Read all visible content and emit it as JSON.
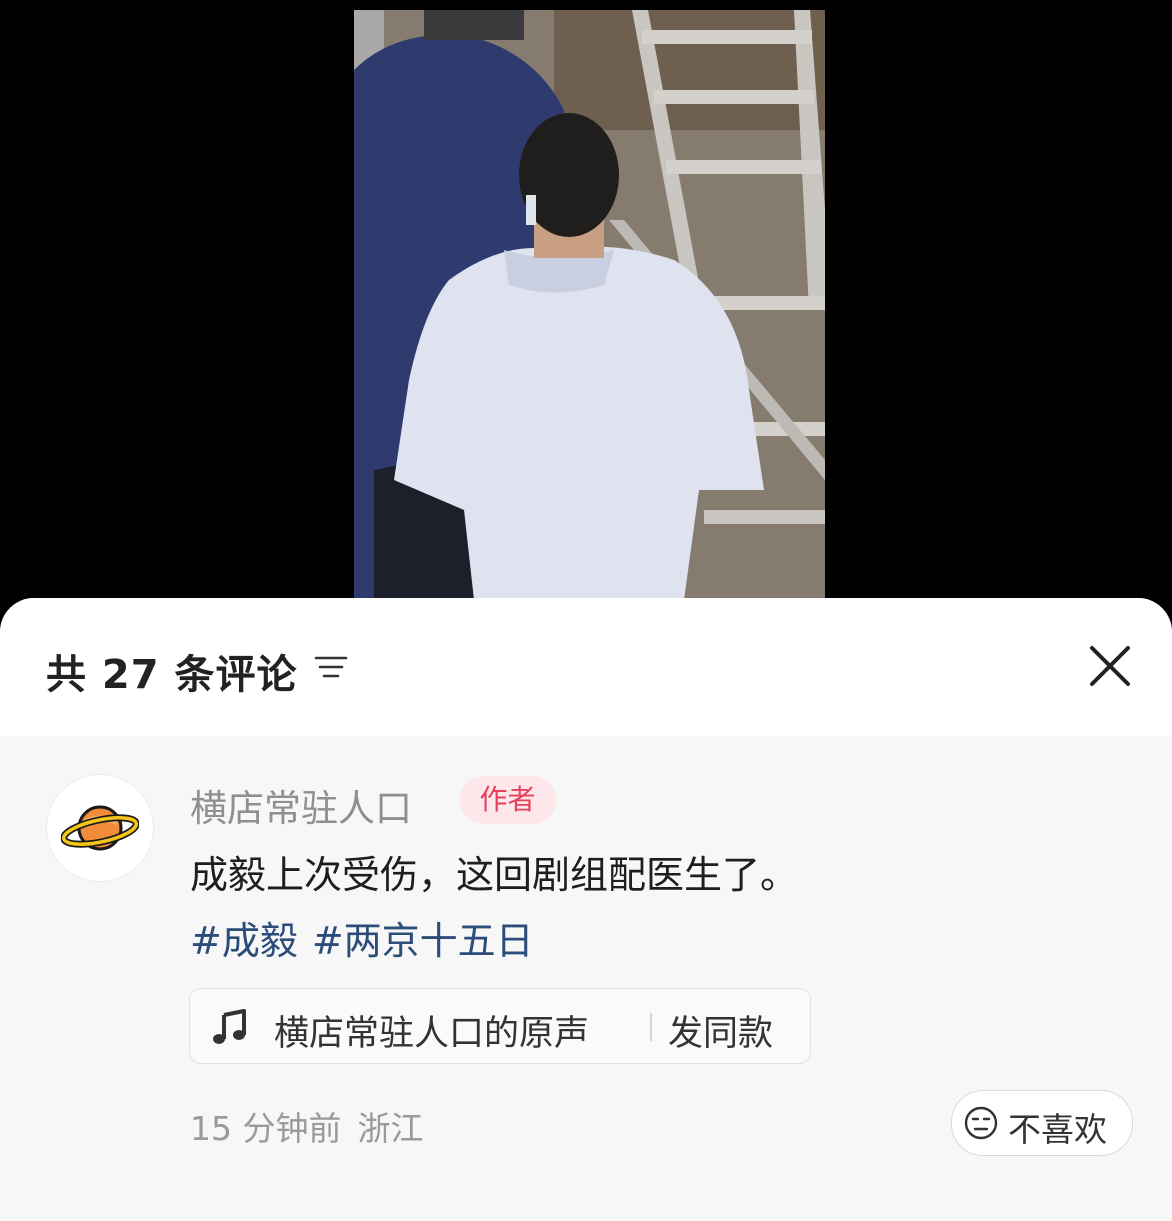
{
  "header": {
    "comment_count_title": "共 27 条评论"
  },
  "icons": {
    "sort": "sort-lines-icon",
    "close": "close-icon",
    "avatar": "planet-icon",
    "music": "music-note-icon",
    "dislike": "neutral-face-icon"
  },
  "comment": {
    "username": "横店常驻人口",
    "badge": "作者",
    "text": "成毅上次受伤，这回剧组配医生了。",
    "tags": [
      "#成毅",
      "#两京十五日"
    ],
    "sound": {
      "name": "横店常驻人口的原声",
      "action": "发同款"
    },
    "time": "15 分钟前",
    "location": "浙江",
    "dislike_label": "不喜欢"
  },
  "colors": {
    "badge_bg": "#fde7ea",
    "badge_text": "#e6405a",
    "tag": "#2c4d7a",
    "sheet_bg": "#f7f7f7"
  }
}
